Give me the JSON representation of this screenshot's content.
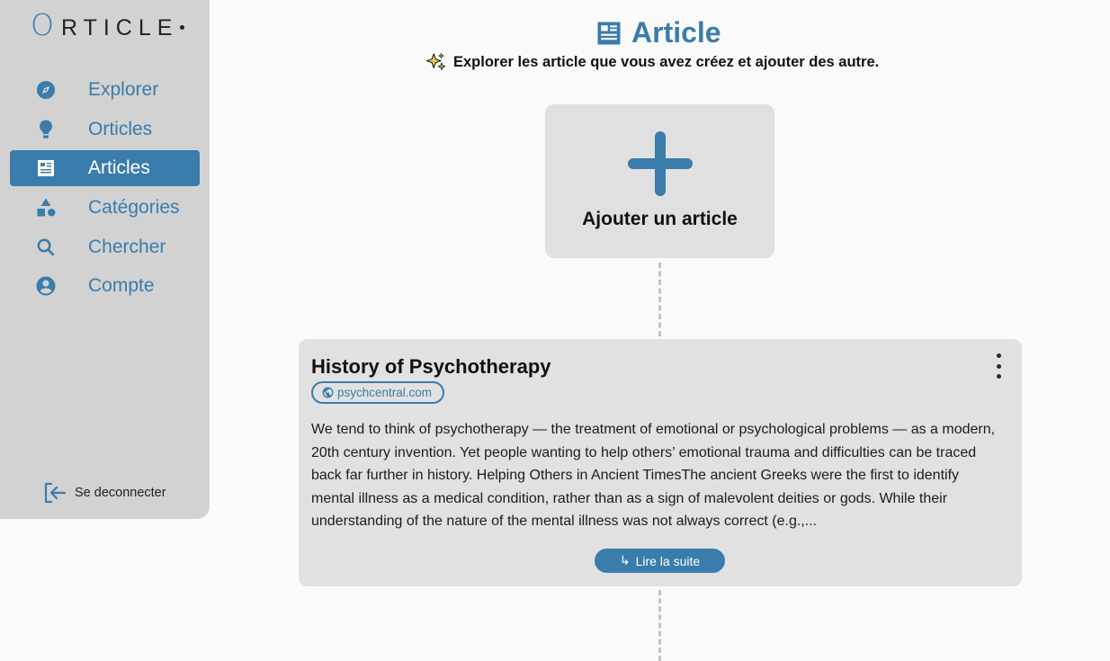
{
  "brand": {
    "logo_initial": "O",
    "logo_rest": "RTICLE"
  },
  "sidebar": {
    "items": [
      {
        "label": "Explorer",
        "icon": "compass-icon",
        "active": false
      },
      {
        "label": "Orticles",
        "icon": "lightbulb-icon",
        "active": false
      },
      {
        "label": "Articles",
        "icon": "newspaper-icon",
        "active": true
      },
      {
        "label": "Catégories",
        "icon": "shapes-icon",
        "active": false
      },
      {
        "label": "Chercher",
        "icon": "search-icon",
        "active": false
      },
      {
        "label": "Compte",
        "icon": "user-circle-icon",
        "active": false
      }
    ],
    "logout_label": "Se deconnecter"
  },
  "header": {
    "title": "Article",
    "subtitle": "Explorer les article que vous avez créez et ajouter des autre."
  },
  "add_card": {
    "label": "Ajouter un article"
  },
  "articles": [
    {
      "title": "History of Psychotherapy",
      "source": "psychcentral.com",
      "excerpt": "We tend to think of psychotherapy — the treatment of emotional or psychological problems — as a modern, 20th century invention. Yet people wanting to help others’ emotional trauma and difficulties can be traced back far further in history. Helping Others in Ancient TimesThe ancient Greeks were the first to identify mental illness as a medical condition, rather than as a sign of malevolent deities or gods. While their understanding of the nature of the mental illness was not always correct (e.g.,...",
      "read_more_label": "Lire la suite",
      "read_more_arrow": "↳"
    }
  ],
  "colors": {
    "accent": "#3a7cab",
    "sidebar_bg": "#d2d2d2",
    "card_bg": "#e1e1e1",
    "page_bg": "#fafafa",
    "sparkle": "#f2c94c"
  }
}
